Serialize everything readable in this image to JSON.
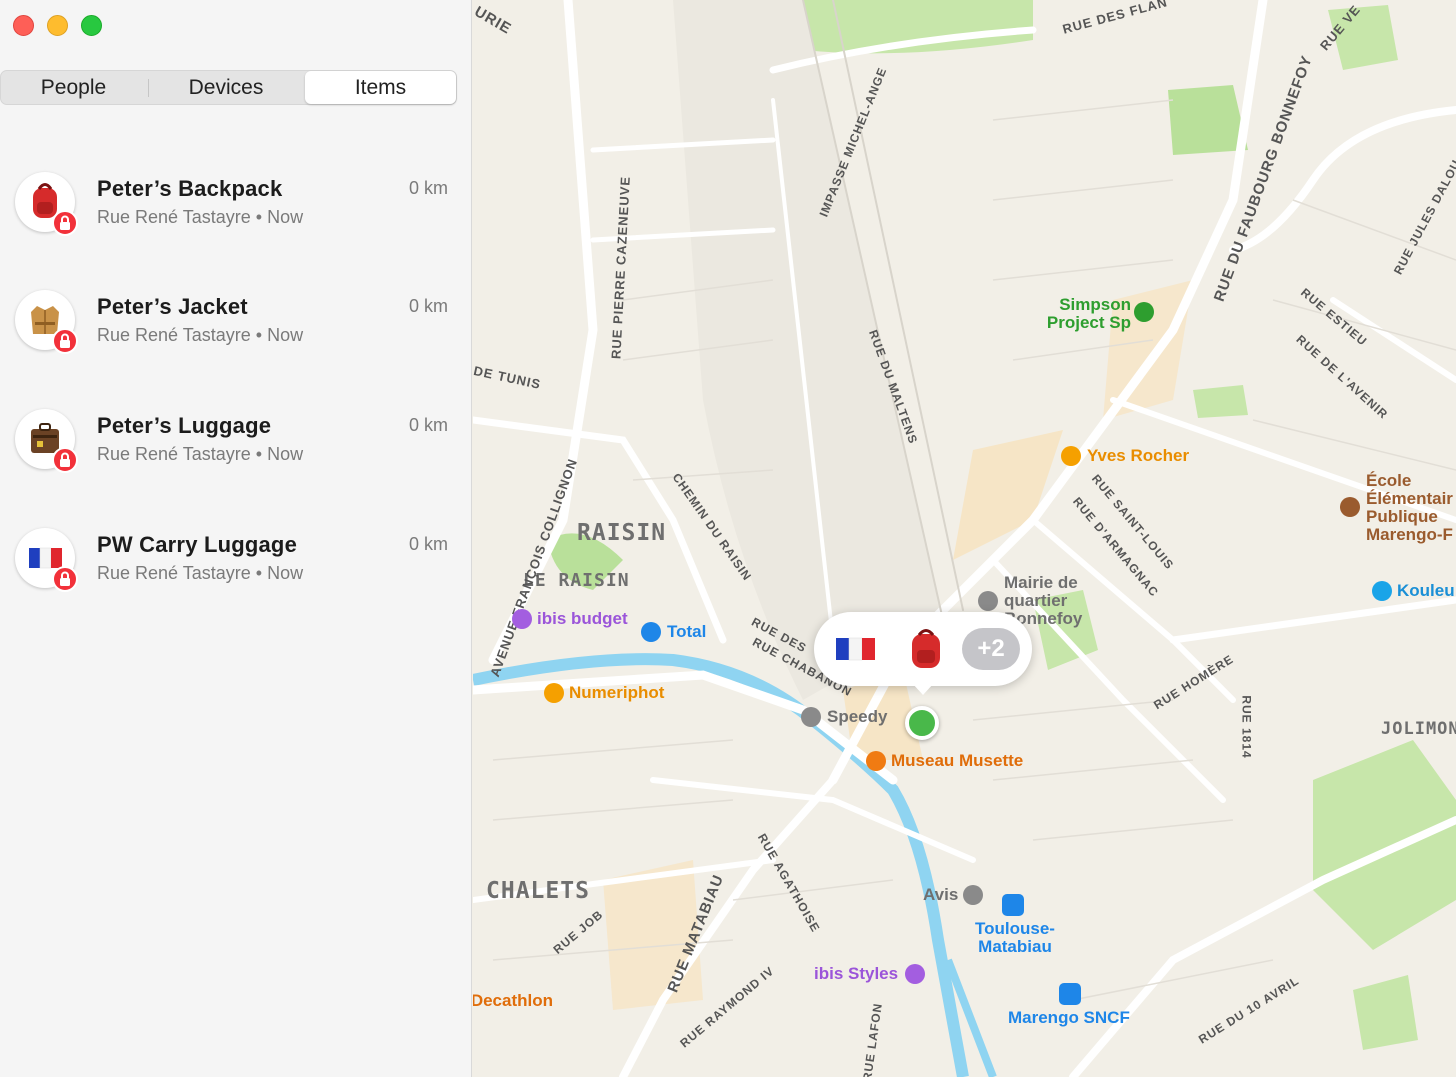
{
  "window": {
    "controls": [
      "close",
      "minimize",
      "zoom"
    ]
  },
  "tabs": [
    {
      "label": "People",
      "selected": false
    },
    {
      "label": "Devices",
      "selected": false
    },
    {
      "label": "Items",
      "selected": true
    }
  ],
  "items": [
    {
      "name": "Peter’s Backpack",
      "location": "Rue René Tastayre",
      "time": "Now",
      "separator": "•",
      "distance": "0 km",
      "icon": "backpack-icon"
    },
    {
      "name": "Peter’s Jacket",
      "location": "Rue René Tastayre",
      "time": "Now",
      "separator": "•",
      "distance": "0 km",
      "icon": "jacket-icon"
    },
    {
      "name": "Peter’s Luggage",
      "location": "Rue René Tastayre",
      "time": "Now",
      "separator": "•",
      "distance": "0 km",
      "icon": "luggage-icon"
    },
    {
      "name": "PW Carry Luggage",
      "location": "Rue René Tastayre",
      "time": "Now",
      "separator": "•",
      "distance": "0 km",
      "icon": "french-flag-icon"
    }
  ],
  "map": {
    "districts": [
      "RAISIN",
      "LE RAISIN",
      "CHALETS",
      "JOLIMONT"
    ],
    "streets": [
      "URIE",
      "RUE DES FLAN",
      "RUE VE",
      "IMPASSE MICHEL-ANGE",
      "RUE DU FAUBOURG BONNEFOY",
      "RUE JULES DALOU",
      "RUE PIERRE CAZENEUVE",
      "DE TUNIS",
      "RUE DU MALTENS",
      "RUE ESTIEU",
      "RUE DE L'AVENIR",
      "AVENUE FRANÇOIS COLLIGNON",
      "CHEMIN DU RAISIN",
      "RUE SAINT-LOUIS",
      "RUE D'ARMAGNAC",
      "RUE DES",
      "RUE CHABANON",
      "RUE HOMÈRE",
      "RUE 1814",
      "RUE AGATHOISE",
      "RUE MATABIAU",
      "RUE JOB",
      "RUE RAYMOND IV",
      "RUE LAFON",
      "RUE DU 10 AVRIL"
    ],
    "pois": [
      {
        "name": "Simpson Project Sp",
        "color": "#2e9e2f"
      },
      {
        "name": "Yves Rocher",
        "color": "#f5a000"
      },
      {
        "name": "École Élémentair Publique Marengo-F",
        "color": "#9a5b2e"
      },
      {
        "name": "Mairie de quartier Bonnefoy",
        "color": "#7d7d7d"
      },
      {
        "name": "Kouleu",
        "color": "#1aa4e8"
      },
      {
        "name": "ibis budget",
        "color": "#a35ee0"
      },
      {
        "name": "Total",
        "color": "#1e86e8"
      },
      {
        "name": "Numeriphot",
        "color": "#f5a000"
      },
      {
        "name": "Speedy",
        "color": "#7d7d7d"
      },
      {
        "name": "Museau Musette",
        "color": "#f07b12"
      },
      {
        "name": "Avis",
        "color": "#7d7d7d"
      },
      {
        "name": "Toulouse-Matabiau",
        "color": "#1e86e8"
      },
      {
        "name": "ibis Styles",
        "color": "#a35ee0"
      },
      {
        "name": "Decathlon",
        "color": "#f07b12"
      },
      {
        "name": "Marengo SNCF",
        "color": "#1e86e8"
      }
    ],
    "callout": {
      "icons": [
        "french-flag-icon",
        "backpack-icon"
      ],
      "more": "+2"
    }
  },
  "colors": {
    "sidebar_bg": "#f5f5f5",
    "lock_badge": "#f2313a",
    "map_bg": "#f2efe7",
    "water": "#8fd4f1",
    "park": "#bfe3a1",
    "location_dot": "#49b84a"
  }
}
